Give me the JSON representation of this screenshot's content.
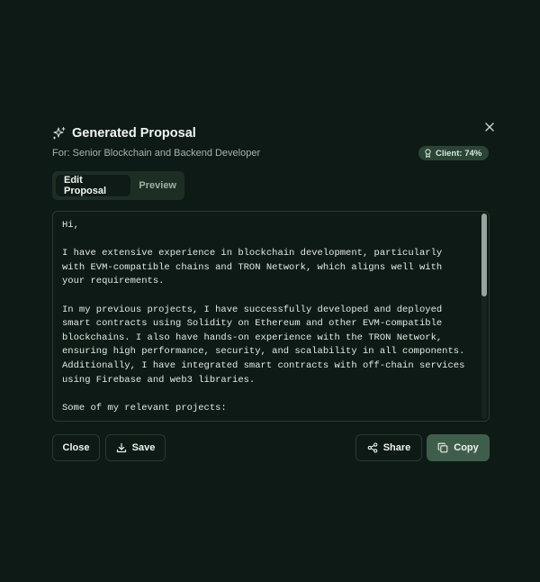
{
  "dialog": {
    "title": "Generated Proposal",
    "subtitle": "For: Senior Blockchain and Backend Developer",
    "badge": "Client: 74%",
    "icons": {
      "title": "sparkles-icon",
      "close": "close-icon",
      "badge": "award-icon"
    }
  },
  "tabs": [
    {
      "label": "Edit Proposal",
      "active": true
    },
    {
      "label": "Preview",
      "active": false
    }
  ],
  "editor": {
    "text": "Hi,\n\nI have extensive experience in blockchain development, particularly with EVM-compatible chains and TRON Network, which aligns well with your requirements.\n\nIn my previous projects, I have successfully developed and deployed smart contracts using Solidity on Ethereum and other EVM-compatible blockchains. I also have hands-on experience with the TRON Network, ensuring high performance, security, and scalability in all components. Additionally, I have integrated smart contracts with off-chain services using Firebase and web3 libraries.\n\nSome of my relevant projects:"
  },
  "buttons": {
    "close": "Close",
    "save": "Save",
    "share": "Share",
    "copy": "Copy"
  },
  "colors": {
    "background": "#0e1a15",
    "accent": "#3e5e4b",
    "badge_bg": "#2b4436"
  }
}
